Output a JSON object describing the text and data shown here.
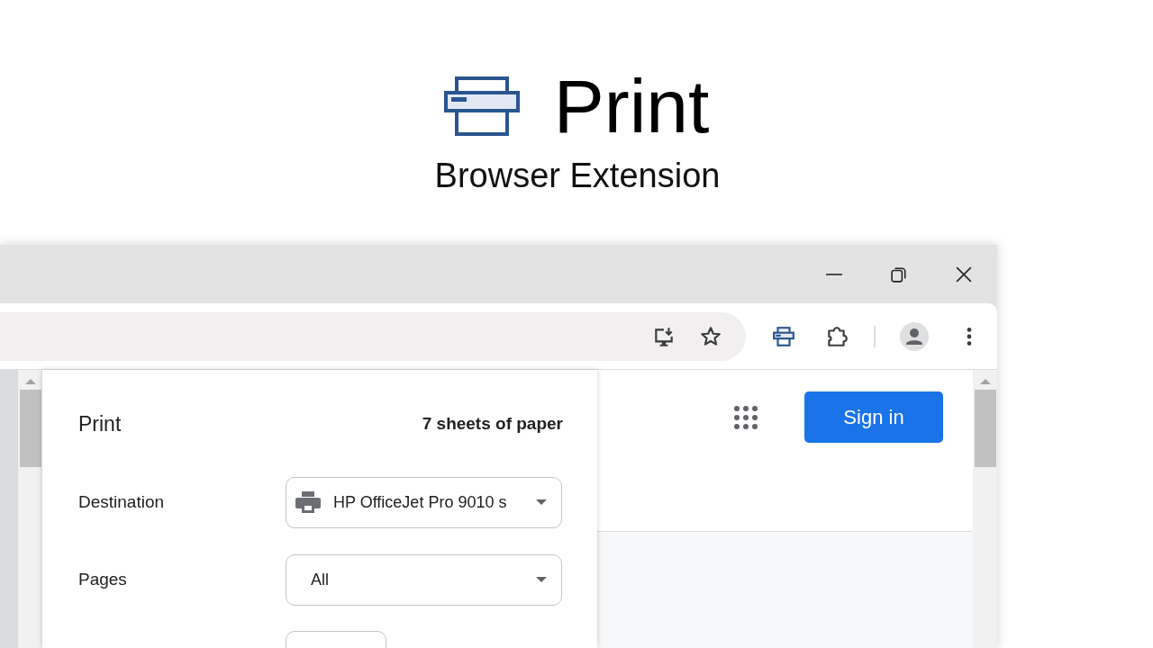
{
  "hero": {
    "title": "Print",
    "subtitle": "Browser Extension"
  },
  "print_dialog": {
    "title": "Print",
    "sheets": "7 sheets of paper",
    "settings": [
      {
        "label": "Destination",
        "value": "HP OfficeJet Pro 9010 s",
        "kind": "printer"
      },
      {
        "label": "Pages",
        "value": "All",
        "kind": "select"
      }
    ]
  },
  "page": {
    "sign_in": "Sign in"
  }
}
